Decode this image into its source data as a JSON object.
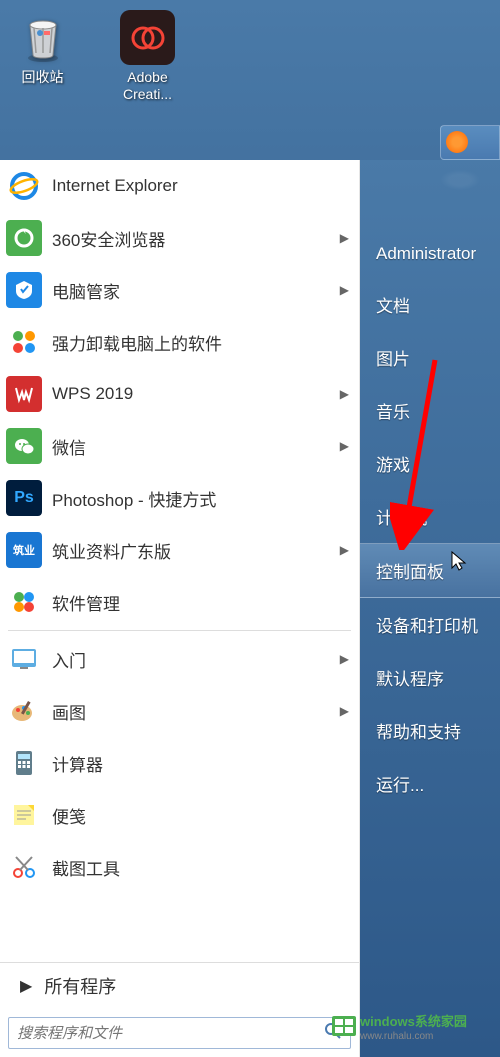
{
  "desktop": {
    "recycle_bin": "回收站",
    "adobe": "Adobe Creati..."
  },
  "start_menu": {
    "left_items": [
      {
        "label": "Internet Explorer",
        "icon": "ie",
        "has_submenu": false
      },
      {
        "label": "360安全浏览器",
        "icon": "360",
        "has_submenu": true
      },
      {
        "label": "电脑管家",
        "icon": "tencent",
        "has_submenu": true
      },
      {
        "label": "强力卸载电脑上的软件",
        "icon": "uninstall",
        "has_submenu": false
      },
      {
        "label": "WPS 2019",
        "icon": "wps",
        "has_submenu": true
      },
      {
        "label": "微信",
        "icon": "wechat",
        "has_submenu": true
      },
      {
        "label": "Photoshop - 快捷方式",
        "icon": "ps",
        "has_submenu": false
      },
      {
        "label": "筑业资料广东版",
        "icon": "zhuye",
        "has_submenu": true
      },
      {
        "label": "软件管理",
        "icon": "soft",
        "has_submenu": false
      },
      {
        "label": "入门",
        "icon": "rumen",
        "has_submenu": true
      },
      {
        "label": "画图",
        "icon": "paint",
        "has_submenu": true
      },
      {
        "label": "计算器",
        "icon": "calc",
        "has_submenu": false
      },
      {
        "label": "便笺",
        "icon": "notes",
        "has_submenu": false
      },
      {
        "label": "截图工具",
        "icon": "snip",
        "has_submenu": false
      }
    ],
    "all_programs": "所有程序",
    "search_placeholder": "搜索程序和文件"
  },
  "right_panel": {
    "items": [
      {
        "label": "Administrator",
        "highlighted": false
      },
      {
        "label": "文档",
        "highlighted": false
      },
      {
        "label": "图片",
        "highlighted": false
      },
      {
        "label": "音乐",
        "highlighted": false
      },
      {
        "label": "游戏",
        "highlighted": false
      },
      {
        "label": "计算机",
        "highlighted": false
      },
      {
        "label": "控制面板",
        "highlighted": true
      },
      {
        "label": "设备和打印机",
        "highlighted": false
      },
      {
        "label": "默认程序",
        "highlighted": false
      },
      {
        "label": "帮助和支持",
        "highlighted": false
      },
      {
        "label": "运行...",
        "highlighted": false
      }
    ]
  },
  "watermark": {
    "text": "windows系统家园",
    "url": "www.ruhalu.com"
  }
}
